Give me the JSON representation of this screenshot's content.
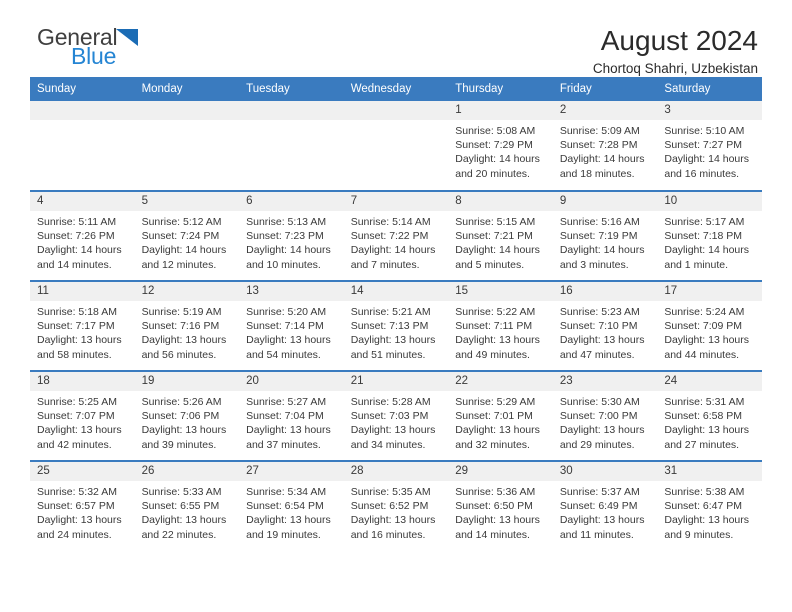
{
  "brand": {
    "name_part1": "General",
    "name_part2": "Blue",
    "logo_icon": "triangle-logo-icon"
  },
  "header": {
    "title": "August 2024",
    "subtitle": "Chortoq Shahri, Uzbekistan"
  },
  "colors": {
    "header_blue": "#3a7bbf",
    "brand_blue": "#2585d3",
    "daynum_band": "#f0f0f0",
    "text": "#3a3a3a"
  },
  "weekday_headers": [
    "Sunday",
    "Monday",
    "Tuesday",
    "Wednesday",
    "Thursday",
    "Friday",
    "Saturday"
  ],
  "weeks": [
    [
      {
        "day": "",
        "empty": true
      },
      {
        "day": "",
        "empty": true
      },
      {
        "day": "",
        "empty": true
      },
      {
        "day": "",
        "empty": true
      },
      {
        "day": "1",
        "sunrise": "Sunrise: 5:08 AM",
        "sunset": "Sunset: 7:29 PM",
        "daylight_line1": "Daylight: 14 hours",
        "daylight_line2": "and 20 minutes."
      },
      {
        "day": "2",
        "sunrise": "Sunrise: 5:09 AM",
        "sunset": "Sunset: 7:28 PM",
        "daylight_line1": "Daylight: 14 hours",
        "daylight_line2": "and 18 minutes."
      },
      {
        "day": "3",
        "sunrise": "Sunrise: 5:10 AM",
        "sunset": "Sunset: 7:27 PM",
        "daylight_line1": "Daylight: 14 hours",
        "daylight_line2": "and 16 minutes."
      }
    ],
    [
      {
        "day": "4",
        "sunrise": "Sunrise: 5:11 AM",
        "sunset": "Sunset: 7:26 PM",
        "daylight_line1": "Daylight: 14 hours",
        "daylight_line2": "and 14 minutes."
      },
      {
        "day": "5",
        "sunrise": "Sunrise: 5:12 AM",
        "sunset": "Sunset: 7:24 PM",
        "daylight_line1": "Daylight: 14 hours",
        "daylight_line2": "and 12 minutes."
      },
      {
        "day": "6",
        "sunrise": "Sunrise: 5:13 AM",
        "sunset": "Sunset: 7:23 PM",
        "daylight_line1": "Daylight: 14 hours",
        "daylight_line2": "and 10 minutes."
      },
      {
        "day": "7",
        "sunrise": "Sunrise: 5:14 AM",
        "sunset": "Sunset: 7:22 PM",
        "daylight_line1": "Daylight: 14 hours",
        "daylight_line2": "and 7 minutes."
      },
      {
        "day": "8",
        "sunrise": "Sunrise: 5:15 AM",
        "sunset": "Sunset: 7:21 PM",
        "daylight_line1": "Daylight: 14 hours",
        "daylight_line2": "and 5 minutes."
      },
      {
        "day": "9",
        "sunrise": "Sunrise: 5:16 AM",
        "sunset": "Sunset: 7:19 PM",
        "daylight_line1": "Daylight: 14 hours",
        "daylight_line2": "and 3 minutes."
      },
      {
        "day": "10",
        "sunrise": "Sunrise: 5:17 AM",
        "sunset": "Sunset: 7:18 PM",
        "daylight_line1": "Daylight: 14 hours",
        "daylight_line2": "and 1 minute."
      }
    ],
    [
      {
        "day": "11",
        "sunrise": "Sunrise: 5:18 AM",
        "sunset": "Sunset: 7:17 PM",
        "daylight_line1": "Daylight: 13 hours",
        "daylight_line2": "and 58 minutes."
      },
      {
        "day": "12",
        "sunrise": "Sunrise: 5:19 AM",
        "sunset": "Sunset: 7:16 PM",
        "daylight_line1": "Daylight: 13 hours",
        "daylight_line2": "and 56 minutes."
      },
      {
        "day": "13",
        "sunrise": "Sunrise: 5:20 AM",
        "sunset": "Sunset: 7:14 PM",
        "daylight_line1": "Daylight: 13 hours",
        "daylight_line2": "and 54 minutes."
      },
      {
        "day": "14",
        "sunrise": "Sunrise: 5:21 AM",
        "sunset": "Sunset: 7:13 PM",
        "daylight_line1": "Daylight: 13 hours",
        "daylight_line2": "and 51 minutes."
      },
      {
        "day": "15",
        "sunrise": "Sunrise: 5:22 AM",
        "sunset": "Sunset: 7:11 PM",
        "daylight_line1": "Daylight: 13 hours",
        "daylight_line2": "and 49 minutes."
      },
      {
        "day": "16",
        "sunrise": "Sunrise: 5:23 AM",
        "sunset": "Sunset: 7:10 PM",
        "daylight_line1": "Daylight: 13 hours",
        "daylight_line2": "and 47 minutes."
      },
      {
        "day": "17",
        "sunrise": "Sunrise: 5:24 AM",
        "sunset": "Sunset: 7:09 PM",
        "daylight_line1": "Daylight: 13 hours",
        "daylight_line2": "and 44 minutes."
      }
    ],
    [
      {
        "day": "18",
        "sunrise": "Sunrise: 5:25 AM",
        "sunset": "Sunset: 7:07 PM",
        "daylight_line1": "Daylight: 13 hours",
        "daylight_line2": "and 42 minutes."
      },
      {
        "day": "19",
        "sunrise": "Sunrise: 5:26 AM",
        "sunset": "Sunset: 7:06 PM",
        "daylight_line1": "Daylight: 13 hours",
        "daylight_line2": "and 39 minutes."
      },
      {
        "day": "20",
        "sunrise": "Sunrise: 5:27 AM",
        "sunset": "Sunset: 7:04 PM",
        "daylight_line1": "Daylight: 13 hours",
        "daylight_line2": "and 37 minutes."
      },
      {
        "day": "21",
        "sunrise": "Sunrise: 5:28 AM",
        "sunset": "Sunset: 7:03 PM",
        "daylight_line1": "Daylight: 13 hours",
        "daylight_line2": "and 34 minutes."
      },
      {
        "day": "22",
        "sunrise": "Sunrise: 5:29 AM",
        "sunset": "Sunset: 7:01 PM",
        "daylight_line1": "Daylight: 13 hours",
        "daylight_line2": "and 32 minutes."
      },
      {
        "day": "23",
        "sunrise": "Sunrise: 5:30 AM",
        "sunset": "Sunset: 7:00 PM",
        "daylight_line1": "Daylight: 13 hours",
        "daylight_line2": "and 29 minutes."
      },
      {
        "day": "24",
        "sunrise": "Sunrise: 5:31 AM",
        "sunset": "Sunset: 6:58 PM",
        "daylight_line1": "Daylight: 13 hours",
        "daylight_line2": "and 27 minutes."
      }
    ],
    [
      {
        "day": "25",
        "sunrise": "Sunrise: 5:32 AM",
        "sunset": "Sunset: 6:57 PM",
        "daylight_line1": "Daylight: 13 hours",
        "daylight_line2": "and 24 minutes."
      },
      {
        "day": "26",
        "sunrise": "Sunrise: 5:33 AM",
        "sunset": "Sunset: 6:55 PM",
        "daylight_line1": "Daylight: 13 hours",
        "daylight_line2": "and 22 minutes."
      },
      {
        "day": "27",
        "sunrise": "Sunrise: 5:34 AM",
        "sunset": "Sunset: 6:54 PM",
        "daylight_line1": "Daylight: 13 hours",
        "daylight_line2": "and 19 minutes."
      },
      {
        "day": "28",
        "sunrise": "Sunrise: 5:35 AM",
        "sunset": "Sunset: 6:52 PM",
        "daylight_line1": "Daylight: 13 hours",
        "daylight_line2": "and 16 minutes."
      },
      {
        "day": "29",
        "sunrise": "Sunrise: 5:36 AM",
        "sunset": "Sunset: 6:50 PM",
        "daylight_line1": "Daylight: 13 hours",
        "daylight_line2": "and 14 minutes."
      },
      {
        "day": "30",
        "sunrise": "Sunrise: 5:37 AM",
        "sunset": "Sunset: 6:49 PM",
        "daylight_line1": "Daylight: 13 hours",
        "daylight_line2": "and 11 minutes."
      },
      {
        "day": "31",
        "sunrise": "Sunrise: 5:38 AM",
        "sunset": "Sunset: 6:47 PM",
        "daylight_line1": "Daylight: 13 hours",
        "daylight_line2": "and 9 minutes."
      }
    ]
  ]
}
